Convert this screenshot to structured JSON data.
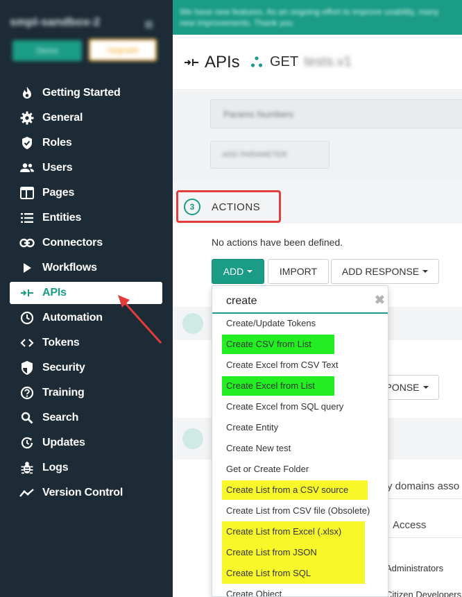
{
  "sidebar": {
    "env_name": "smpl-sandbox-2",
    "env_btn_primary": "Demo",
    "env_btn_secondary": "Upgrade",
    "items": [
      {
        "label": "Getting Started",
        "icon": "flame-icon"
      },
      {
        "label": "General",
        "icon": "gear-icon"
      },
      {
        "label": "Roles",
        "icon": "shield-check-icon"
      },
      {
        "label": "Users",
        "icon": "users-icon"
      },
      {
        "label": "Pages",
        "icon": "window-icon"
      },
      {
        "label": "Entities",
        "icon": "list-icon"
      },
      {
        "label": "Connectors",
        "icon": "link-icon"
      },
      {
        "label": "Workflows",
        "icon": "play-icon"
      },
      {
        "label": "APIs",
        "icon": "api-arrows-icon",
        "active": true
      },
      {
        "label": "Automation",
        "icon": "clock-icon"
      },
      {
        "label": "Tokens",
        "icon": "code-brackets-icon"
      },
      {
        "label": "Security",
        "icon": "shield-half-icon"
      },
      {
        "label": "Training",
        "icon": "help-circle-icon"
      },
      {
        "label": "Search",
        "icon": "search-icon"
      },
      {
        "label": "Updates",
        "icon": "update-clock-icon"
      },
      {
        "label": "Logs",
        "icon": "bug-icon"
      },
      {
        "label": "Version Control",
        "icon": "trend-line-icon"
      }
    ]
  },
  "banner": {
    "text": "We have new features. As an ongoing effort to improve usability, many new improvements. Thank you"
  },
  "header": {
    "title": "APIs",
    "method": "GET",
    "api_name": "tests.v1"
  },
  "params": {
    "row_label": "Params Numbers",
    "add_param_label": "ADD PARAMETER"
  },
  "actions": {
    "step_number": "3",
    "title": "ACTIONS",
    "empty_text": "No actions have been defined.",
    "add_label": "ADD",
    "import_label": "IMPORT",
    "add_response_label": "ADD RESPONSE"
  },
  "background": {
    "response_fragment": "PONSE",
    "domains_fragment": "y domains asso",
    "access_fragment": "Access",
    "admins_fragment": "Administrators",
    "citizens_fragment": "Citizen Developers"
  },
  "dropdown": {
    "search_value": "create",
    "clear_glyph": "✖",
    "items": [
      {
        "label": "Create/Update Tokens",
        "highlight": "none"
      },
      {
        "label": "Create CSV from List",
        "highlight": "green"
      },
      {
        "label": "Create Excel from CSV Text",
        "highlight": "none"
      },
      {
        "label": "Create Excel from List",
        "highlight": "green"
      },
      {
        "label": "Create Excel from SQL query",
        "highlight": "none"
      },
      {
        "label": "Create Entity",
        "highlight": "none"
      },
      {
        "label": "Create New test",
        "highlight": "none"
      },
      {
        "label": "Get or Create Folder",
        "highlight": "none"
      },
      {
        "label": "Create List from a CSV source",
        "highlight": "yellow"
      },
      {
        "label": "Create List from CSV file (Obsolete)",
        "highlight": "none"
      },
      {
        "label": "Create List from Excel (.xlsx)",
        "highlight": "yellow"
      },
      {
        "label": "Create List from JSON",
        "highlight": "yellow"
      },
      {
        "label": "Create List from SQL",
        "highlight": "yellow"
      },
      {
        "label": "Create Object",
        "highlight": "none"
      }
    ]
  },
  "colors": {
    "sidebar_bg": "#1c2b35",
    "accent": "#1a9c87",
    "annotation_red": "#e23c3c",
    "highlight_green": "#22ee22",
    "highlight_yellow": "#f7f72a"
  }
}
